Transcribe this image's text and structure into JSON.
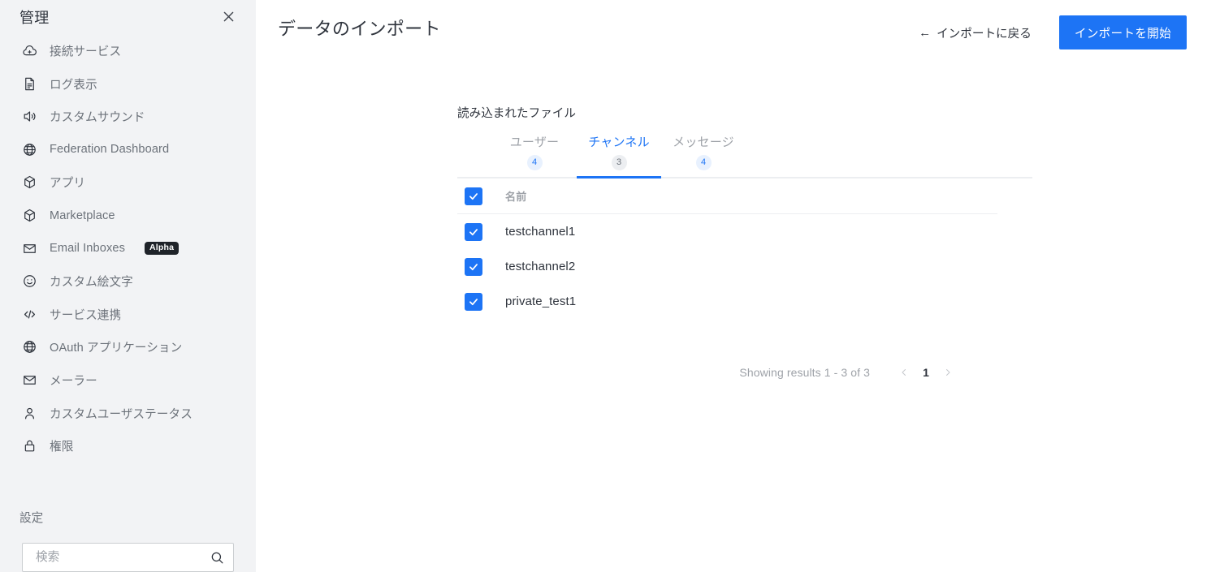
{
  "sidebar": {
    "title": "管理",
    "close_icon": "close-icon",
    "items": [
      {
        "icon": "cloud-plus-icon",
        "label": "接続サービス"
      },
      {
        "icon": "document-icon",
        "label": "ログ表示"
      },
      {
        "icon": "speaker-icon",
        "label": "カスタムサウンド"
      },
      {
        "icon": "globe-icon",
        "label": "Federation Dashboard"
      },
      {
        "icon": "cube-icon",
        "label": "アプリ"
      },
      {
        "icon": "cube-icon",
        "label": "Marketplace"
      },
      {
        "icon": "mail-icon",
        "label": "Email Inboxes",
        "badge": "Alpha"
      },
      {
        "icon": "smiley-icon",
        "label": "カスタム絵文字"
      },
      {
        "icon": "code-icon",
        "label": "サービス連携"
      },
      {
        "icon": "globe-icon",
        "label": "OAuth アプリケーション"
      },
      {
        "icon": "mail-icon",
        "label": "メーラー"
      },
      {
        "icon": "user-icon",
        "label": "カスタムユーザステータス"
      },
      {
        "icon": "lock-icon",
        "label": "権限"
      }
    ],
    "section_title": "設定",
    "search": {
      "placeholder": "検索",
      "value": "",
      "icon": "search-icon"
    }
  },
  "header": {
    "title": "データのインポート",
    "back_arrow": "←",
    "back_label": "インポートに戻る",
    "start_label": "インポートを開始"
  },
  "main": {
    "section_label": "読み込まれたファイル",
    "tabs": [
      {
        "label": "ユーザー",
        "count": "4",
        "active": false
      },
      {
        "label": "チャンネル",
        "count": "3",
        "active": true
      },
      {
        "label": "メッセージ",
        "count": "4",
        "active": false
      }
    ],
    "table": {
      "header_checkbox_checked": true,
      "columns": [
        "名前"
      ],
      "rows": [
        {
          "name": "testchannel1",
          "checked": true
        },
        {
          "name": "testchannel2",
          "checked": true
        },
        {
          "name": "private_test1",
          "checked": true
        }
      ]
    },
    "pagination": {
      "results_text": "Showing results 1 - 3 of 3",
      "prev_icon": "chevron-left-icon",
      "page": "1",
      "next_icon": "chevron-right-icon"
    }
  },
  "colors": {
    "accent": "#1d74f5",
    "sidebar_bg": "#f2f3f5",
    "text_primary": "#2f343d",
    "text_muted": "#9ea2a8",
    "badge_bg": "#e8f1fe",
    "alpha_badge_bg": "#1f2329"
  }
}
